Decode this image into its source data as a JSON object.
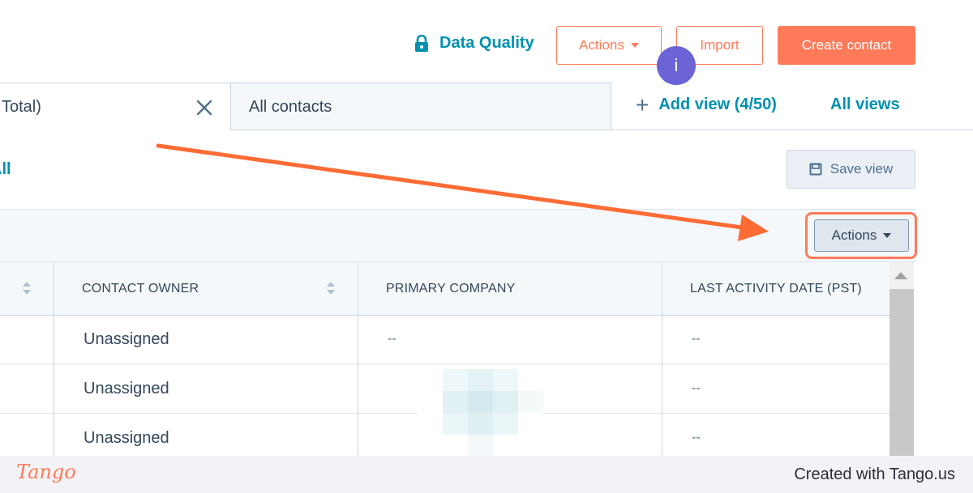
{
  "header": {
    "data_quality_label": "Data Quality",
    "actions_label": "Actions",
    "import_label": "Import",
    "create_contact_label": "Create contact",
    "info_badge": "i"
  },
  "tabs": {
    "first_tab_label": "Total)",
    "all_contacts_label": "All contacts",
    "add_view_label": "Add view (4/50)",
    "all_views_label": "All views"
  },
  "filters": {
    "edge_link_text": "All",
    "save_view_label": "Save view"
  },
  "table_toolbar": {
    "actions_label": "Actions"
  },
  "table": {
    "columns": [
      "CONTACT OWNER",
      "PRIMARY COMPANY",
      "LAST ACTIVITY DATE (PST)"
    ],
    "rows": [
      {
        "owner": "Unassigned",
        "company": "--",
        "last_activity": "--"
      },
      {
        "owner": "Unassigned",
        "company": "",
        "last_activity": "--"
      },
      {
        "owner": "Unassigned",
        "company": "",
        "last_activity": "--"
      }
    ]
  },
  "footer": {
    "brand": "Tango",
    "credit": "Created with Tango.us"
  },
  "colors": {
    "accent": "#ff7a59",
    "link": "#0091ae",
    "badge": "#6c63d6",
    "text": "#33475b"
  }
}
